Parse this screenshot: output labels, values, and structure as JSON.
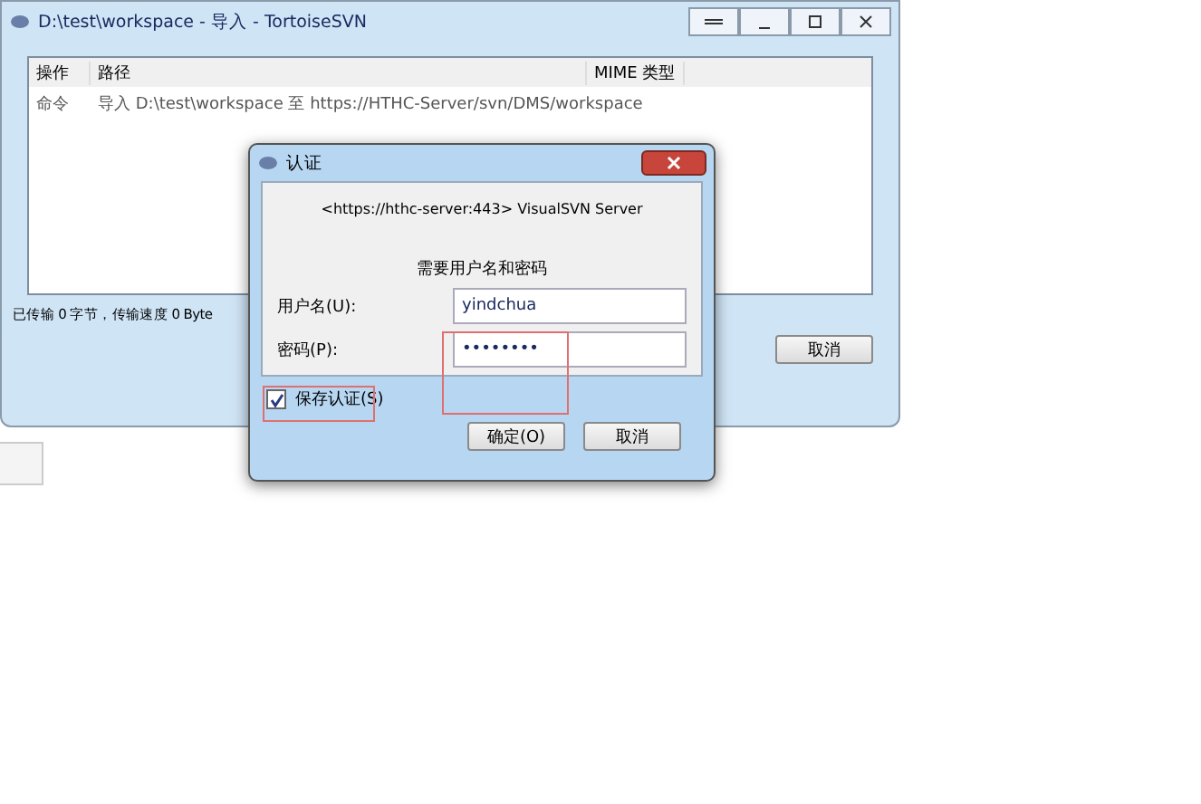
{
  "main_window": {
    "title": "D:\\test\\workspace - 导入 - TortoiseSVN",
    "table": {
      "columns": [
        "操作",
        "路径",
        "MIME 类型"
      ],
      "rows": [
        {
          "action": "命令",
          "path": "导入 D:\\test\\workspace 至 https://HTHC-Server/svn/DMS/workspace"
        }
      ]
    },
    "status": "已传输 0 字节，传输速度 0 Byte",
    "buttons": [
      "取消"
    ]
  },
  "auth_dialog": {
    "title": "认证",
    "realm": "<https://hthc-server:443> VisualSVN Server",
    "prompt": "需要用户名和密码",
    "username_label": "用户名(U):",
    "username": "yindchua",
    "password_label": "密码(P):",
    "password": "••••••••",
    "save_auth": {
      "label": "保存认证(S)",
      "checked": true
    },
    "buttons": [
      "确定(O)",
      "取消"
    ]
  }
}
